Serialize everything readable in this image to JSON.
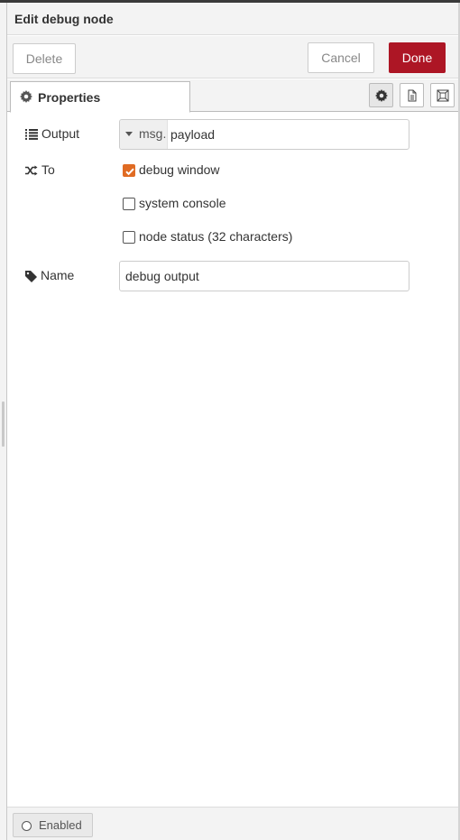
{
  "header": {
    "title": "Edit debug node"
  },
  "toolbar": {
    "delete_label": "Delete",
    "cancel_label": "Cancel",
    "done_label": "Done"
  },
  "tabs": [
    {
      "label": "Properties",
      "icon": "gear-icon",
      "active": true
    }
  ],
  "tab_tools": [
    {
      "icon": "gear-icon",
      "active": true
    },
    {
      "icon": "document-icon",
      "active": false
    },
    {
      "icon": "frame-icon",
      "active": false
    }
  ],
  "form": {
    "output": {
      "label": "Output",
      "icon": "list-icon",
      "type_prefix": "msg.",
      "value": "payload"
    },
    "to": {
      "label": "To",
      "icon": "shuffle-icon",
      "options": [
        {
          "label": "debug window",
          "checked": true
        },
        {
          "label": "system console",
          "checked": false
        },
        {
          "label": "node status (32 characters)",
          "checked": false
        }
      ]
    },
    "name": {
      "label": "Name",
      "icon": "tag-icon",
      "value": "debug output"
    }
  },
  "footer": {
    "enabled_label": "Enabled"
  },
  "colors": {
    "done": "#ad1625",
    "checkbox_checked": "#e06b23"
  }
}
